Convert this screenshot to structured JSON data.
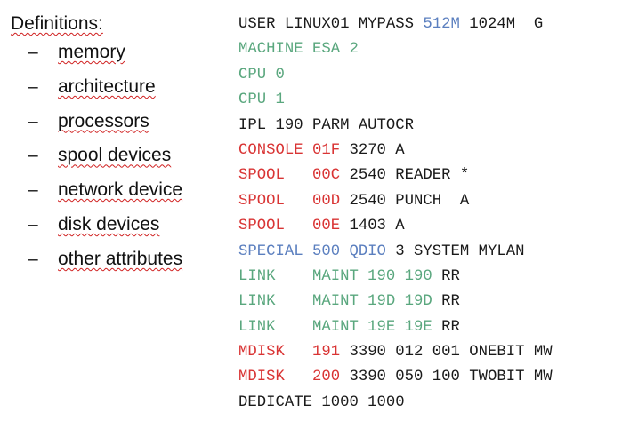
{
  "colors": {
    "text": "#1a1a1a",
    "green": "#5aa77e",
    "red": "#d93434",
    "blue": "#5b7fbf",
    "spellcheck_underline": "#d02020"
  },
  "definitions": {
    "heading": "Definitions:",
    "bullet": "–",
    "items": [
      "memory",
      "architecture",
      "processors",
      "spool devices",
      "network device",
      "disk devices",
      "other attributes"
    ]
  },
  "code_lines": [
    [
      {
        "t": "USER LINUX01 MYPASS ",
        "c": "text"
      },
      {
        "t": "512M",
        "c": "blue"
      },
      {
        "t": " 1024M  G",
        "c": "text"
      }
    ],
    [
      {
        "t": "MACHINE ESA 2",
        "c": "green"
      }
    ],
    [
      {
        "t": "CPU 0",
        "c": "green"
      }
    ],
    [
      {
        "t": "CPU 1",
        "c": "green"
      }
    ],
    [
      {
        "t": "IPL 190 PARM AUTOCR",
        "c": "text"
      }
    ],
    [
      {
        "t": "CONSOLE 01F",
        "c": "red"
      },
      {
        "t": " 3270 A",
        "c": "text"
      }
    ],
    [
      {
        "t": "SPOOL   00C",
        "c": "red"
      },
      {
        "t": " 2540 READER *",
        "c": "text"
      }
    ],
    [
      {
        "t": "SPOOL   00D",
        "c": "red"
      },
      {
        "t": " 2540 PUNCH  A",
        "c": "text"
      }
    ],
    [
      {
        "t": "SPOOL   00E",
        "c": "red"
      },
      {
        "t": " 1403 A",
        "c": "text"
      }
    ],
    [
      {
        "t": "SPECIAL 500 QDIO",
        "c": "blue"
      },
      {
        "t": " 3 SYSTEM MYLAN",
        "c": "text"
      }
    ],
    [
      {
        "t": "LINK    MAINT 190 190",
        "c": "green"
      },
      {
        "t": " RR",
        "c": "text"
      }
    ],
    [
      {
        "t": "LINK    MAINT 19D 19D",
        "c": "green"
      },
      {
        "t": " RR",
        "c": "text"
      }
    ],
    [
      {
        "t": "LINK    MAINT 19E 19E",
        "c": "green"
      },
      {
        "t": " RR",
        "c": "text"
      }
    ],
    [
      {
        "t": "MDISK   191",
        "c": "red"
      },
      {
        "t": " 3390 012 001 ONEBIT MW",
        "c": "text"
      }
    ],
    [
      {
        "t": "MDISK   200",
        "c": "red"
      },
      {
        "t": " 3390 050 100 TWOBIT MW",
        "c": "text"
      }
    ],
    [
      {
        "t": "DEDICATE 1000 1000",
        "c": "text"
      }
    ]
  ]
}
